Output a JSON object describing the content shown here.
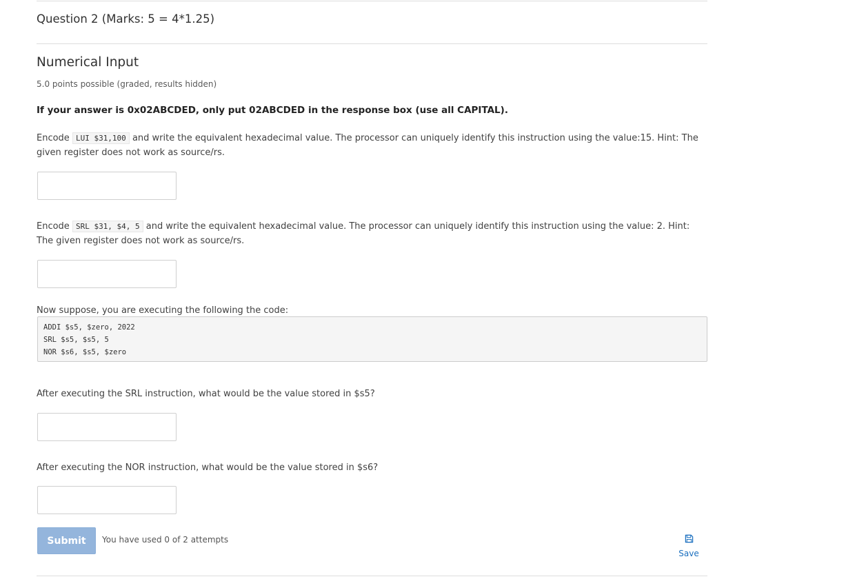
{
  "question_header": "Question 2 (Marks: 5 = 4*1.25)",
  "problem": {
    "title": "Numerical Input",
    "points": "5.0 points possible (graded, results hidden)",
    "instruction": "If your answer is 0x02ABCDED, only put 02ABCDED in the response box (use all CAPITAL)."
  },
  "q1": {
    "prefix": "Encode",
    "code": "LUI $31,100",
    "suffix": " and write the equivalent hexadecimal value. The processor can uniquely identify this instruction using the value:15. Hint: The given register does not work as source/rs.",
    "answer": ""
  },
  "q2": {
    "prefix": "Encode",
    "code": "SRL $31, $4, 5",
    "suffix": " and write the equivalent hexadecimal value. The processor can uniquely identify this instruction using the value: 2. Hint: The given register does not work as source/rs.",
    "answer": ""
  },
  "code_intro": "Now suppose, you are executing the following the code:",
  "code_lines": [
    "ADDI $s5, $zero, 2022",
    "SRL $s5, $s5, 5",
    "NOR $s6, $s5, $zero"
  ],
  "q3": {
    "text": "After executing the SRL instruction, what would be the value stored in $s5?",
    "answer": ""
  },
  "q4": {
    "text": "After executing the NOR instruction, what would be the value stored in $s6?",
    "answer": ""
  },
  "actions": {
    "submit_label": "Submit",
    "attempts_text": "You have used 0 of 2 attempts",
    "save_label": "Save",
    "save_icon": "floppy-disk-icon"
  },
  "colors": {
    "submit_bg": "#94b5dc",
    "link": "#1a6fbf"
  }
}
